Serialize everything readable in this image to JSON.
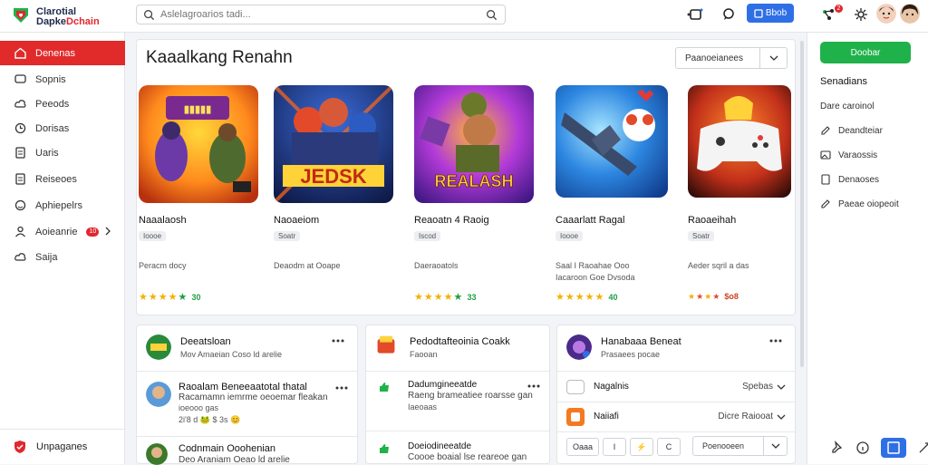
{
  "app": {
    "logo_line1": "Clarotial",
    "logo_line2a": "Dapke",
    "logo_line2b": "Dchain"
  },
  "search": {
    "placeholder": "Aslelagroarios tadi..."
  },
  "header": {
    "primary_button": "Bbob",
    "notification_count": "2"
  },
  "sidebar": {
    "items": [
      {
        "label": "Denenas",
        "icon": "home-icon",
        "active": true
      },
      {
        "label": "Sopnis",
        "icon": "chat-icon"
      },
      {
        "label": "Peeods",
        "icon": "cloud-icon"
      },
      {
        "label": "Dorisas",
        "icon": "clock-icon"
      },
      {
        "label": "Uaris",
        "icon": "document-icon"
      },
      {
        "label": "Reiseoes",
        "icon": "document-icon"
      },
      {
        "label": "Aphiepelrs",
        "icon": "emoji-icon"
      },
      {
        "label": "Aoieanrie",
        "icon": "user-icon",
        "count": "10"
      },
      {
        "label": "Saija",
        "icon": "cloud-icon"
      }
    ],
    "bottom_label": "Unpaganes"
  },
  "featured": {
    "title": "Kaaalkang Renahn",
    "sort_label": "Paanoeianees",
    "games": [
      {
        "name": "Naaalaosh",
        "chip": "Ioooe",
        "desc": [
          "Peracm docy"
        ],
        "rating": 3.5,
        "rating_text": "30",
        "rating_color": "green"
      },
      {
        "name": "Naoaeiom",
        "chip": "Soatr",
        "desc": [
          "Deaodm at Ooape"
        ],
        "rating": 0,
        "rating_text": "",
        "rating_color": "green"
      },
      {
        "name": "Reaoatn 4 Raoig",
        "chip": "Iscod",
        "desc": [
          "Daeraoatols"
        ],
        "rating": 4,
        "rating_text": "33",
        "rating_color": "green"
      },
      {
        "name": "Caaarlatt Ragal",
        "chip": "Ioooe",
        "desc": [
          "Saal I Raoahae Ooo",
          "Iacaroon Goe Dvsoda"
        ],
        "rating": 4.5,
        "rating_text": "40",
        "rating_color": "green"
      },
      {
        "name": "Raoaeihah",
        "chip": "Soatr",
        "desc": [
          "Aeder sqril a das"
        ],
        "rating": 3,
        "rating_text": "$o8",
        "rating_color": "red"
      }
    ]
  },
  "posts": [
    {
      "name": "Deeatsloan",
      "sub": "Mov Amaeian Coso ld arelie",
      "reply": {
        "name": "Raoalam Beneeaatotal thatal",
        "line2": "Racamamn iemrme oeoemar fleakan",
        "line3": "ioeooo gas",
        "line4": "2i'8 d 🐸 $ 3s 😊"
      },
      "reply2": {
        "name": "Codnmain Ooohenian",
        "line2": "Deo Araniam Oeao ld arelie"
      }
    },
    {
      "name": "Pedodtafteoinia Coakk",
      "sub": "Faooan",
      "items": [
        {
          "t1": "Dadumgineeatde",
          "t2": "Raeng brameatiee roarsse gan",
          "t3": "Iaeoaas"
        },
        {
          "t1": "Doeiodineeatde",
          "t2": "Coooe boaial lse reareoe gan"
        }
      ]
    },
    {
      "name": "Hanabaaa Beneat",
      "sub": "Prasaees pocae",
      "rows": [
        {
          "label": "Nagalnis",
          "value": "Spebas"
        },
        {
          "label": "Naiiafi",
          "value": "Dicre Raiooat"
        }
      ],
      "footer_select": "Poenooeen",
      "footer_buttons": [
        "Oaaa",
        "I",
        "⚡",
        "C"
      ]
    }
  ],
  "rightbar": {
    "cta": "Doobar",
    "heading": "Senadians",
    "items": [
      {
        "label": "Dare caroinol",
        "icon": ""
      },
      {
        "label": "Deandteiar",
        "icon": "edit-icon"
      },
      {
        "label": "Varaossis",
        "icon": "image-icon"
      },
      {
        "label": "Denaoses",
        "icon": "document-icon"
      },
      {
        "label": "Paeae oiopeoit",
        "icon": "edit-icon"
      }
    ]
  }
}
